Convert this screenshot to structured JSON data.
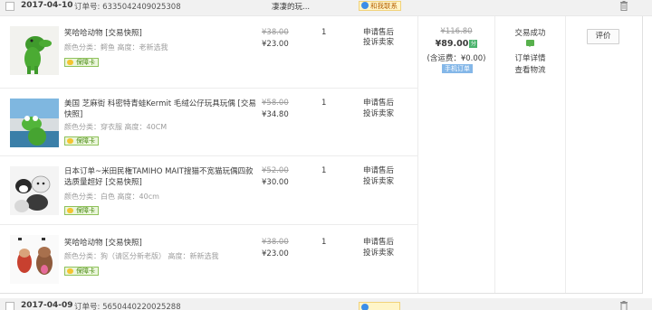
{
  "order": {
    "date": "2017-04-10",
    "order_no_label": "订单号:",
    "order_no": "6335042409025308",
    "shop_name": "凄凄的玩...",
    "contact_label": "和我联系",
    "items": [
      {
        "title": "笑哈哈动物 [交易快照]",
        "props": "颜色分类：鳄鱼  高度：老新选我",
        "badge": "保障卡",
        "orig_price": "¥38.00",
        "price": "¥23.00",
        "qty": "1",
        "action1": "申请售后",
        "action2": "投诉卖家"
      },
      {
        "title": "美国 芝麻街 科密特青蛙Kermit 毛绒公仔玩具玩偶 [交易快照]",
        "props": "颜色分类：穿衣服  高度：40CM",
        "badge": "保障卡",
        "orig_price": "¥58.00",
        "price": "¥34.80",
        "qty": "1",
        "action1": "申请售后",
        "action2": "投诉卖家"
      },
      {
        "title": "日本订单~米田民権TAMIHO MAIT搜猫不宽猫玩偶四款选质量超好 [交易快照]",
        "props": "颜色分类：白色  高度：40cm",
        "badge": "保障卡",
        "orig_price": "¥52.00",
        "price": "¥30.00",
        "qty": "1",
        "action1": "申请售后",
        "action2": "投诉卖家"
      },
      {
        "title": "笑哈哈动物 [交易快照]",
        "props": "颜色分类：狗（请区分新老版）  高度：新新选我",
        "badge": "保障卡",
        "orig_price": "¥38.00",
        "price": "¥23.00",
        "qty": "1",
        "action1": "申请售后",
        "action2": "投诉卖家"
      }
    ],
    "total_orig": "¥116.80",
    "total_paid": "¥89.00",
    "paid_icon": "分",
    "shipping": "(含运费：¥0.00)",
    "mobile_order": "手机订单",
    "status": "交易成功",
    "status_icon": "message-icon",
    "detail_link": "订单详情",
    "logistics_link": "查看物流",
    "review_button": "评价"
  },
  "next_order": {
    "date": "2017-04-09",
    "order_no_label": "订单号:",
    "order_no": "5650440220025288"
  },
  "colors": {
    "header_bg": "#f1f1f1",
    "badge_green": "#4a8b12",
    "contact_bg": "#fff5c8",
    "mobile_badge": "#84b7e8",
    "status_green": "#57b04c"
  }
}
